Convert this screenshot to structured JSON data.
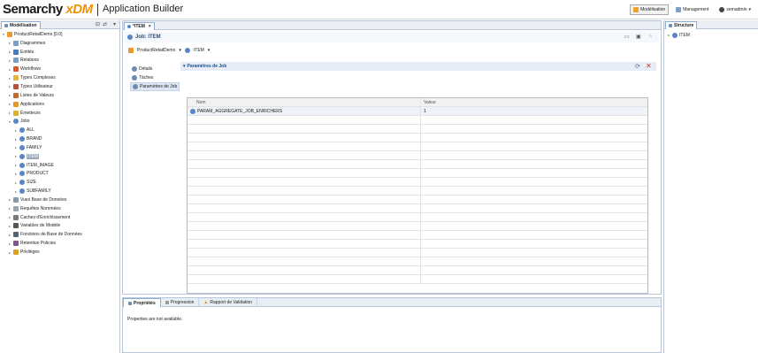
{
  "header": {
    "logo_main": "Semarchy ",
    "logo_xdm": "xDM",
    "app_title": "Application Builder",
    "buttons": [
      {
        "label": "Modélisation",
        "active": true
      },
      {
        "label": "Management",
        "active": false
      },
      {
        "label": "semadmin",
        "active": false
      }
    ]
  },
  "left": {
    "tab": "Modélisation",
    "tree": [
      {
        "label": "ProductRetailDemo [0.0]",
        "level": 0,
        "icon": "model-icon"
      },
      {
        "label": "Diagrammes",
        "level": 1,
        "icon": "diagram-icon"
      },
      {
        "label": "Entités",
        "level": 1,
        "icon": "entity-icon"
      },
      {
        "label": "Relations",
        "level": 1,
        "icon": "relation-icon"
      },
      {
        "label": "Workflows",
        "level": 1,
        "icon": "workflow-icon"
      },
      {
        "label": "Types Complexes",
        "level": 1,
        "icon": "complex-type-icon"
      },
      {
        "label": "Types Utilisateur",
        "level": 1,
        "icon": "user-type-icon"
      },
      {
        "label": "Listes de Valeurs",
        "level": 1,
        "icon": "list-icon"
      },
      {
        "label": "Applications",
        "level": 1,
        "icon": "application-icon"
      },
      {
        "label": "Émetteurs",
        "level": 1,
        "icon": "publisher-icon"
      },
      {
        "label": "Jobs",
        "level": 1,
        "icon": "job-icon"
      },
      {
        "label": "ALL",
        "level": 2,
        "icon": "job-icon"
      },
      {
        "label": "BRAND",
        "level": 2,
        "icon": "job-icon"
      },
      {
        "label": "FAMILY",
        "level": 2,
        "icon": "job-icon"
      },
      {
        "label": "ITEM",
        "level": 2,
        "icon": "job-icon",
        "selected": true
      },
      {
        "label": "ITEM_IMAGE",
        "level": 2,
        "icon": "job-icon"
      },
      {
        "label": "PRODUCT",
        "level": 2,
        "icon": "job-icon"
      },
      {
        "label": "SIZE",
        "level": 2,
        "icon": "job-icon"
      },
      {
        "label": "SUBFAMILY",
        "level": 2,
        "icon": "job-icon"
      },
      {
        "label": "Vues Base de Données",
        "level": 1,
        "icon": "db-view-icon"
      },
      {
        "label": "Requêtes Nommées",
        "level": 1,
        "icon": "query-icon"
      },
      {
        "label": "Caches d'Enrichissement",
        "level": 1,
        "icon": "cache-icon"
      },
      {
        "label": "Variables de Modèle",
        "level": 1,
        "icon": "variable-icon"
      },
      {
        "label": "Fonctions de Base de Données",
        "level": 1,
        "icon": "function-icon"
      },
      {
        "label": "Retention Policies",
        "level": 1,
        "icon": "retention-icon"
      },
      {
        "label": "Privilèges",
        "level": 1,
        "icon": "privilege-icon"
      }
    ]
  },
  "center": {
    "tab": "*ITEM",
    "editor_title": "Job: ITEM",
    "crumbs": [
      "ProductRetailDemo",
      "ITEM"
    ],
    "nav": [
      "Détails",
      "Tâches",
      "Paramètres de Job"
    ],
    "section_title": "Paramètres de Job",
    "grid": {
      "headers": [
        "Nom",
        "Valeur"
      ],
      "rows": [
        {
          "name": "PARAM_AGGREGATE_JOB_ENRICHERS",
          "value": "1"
        }
      ]
    }
  },
  "bottom": {
    "tabs": [
      "Propriétés",
      "Progression",
      "Rapport de Validation"
    ],
    "message": "Properties are not available."
  },
  "right": {
    "tab": "Structure",
    "tree": [
      "ITEM"
    ]
  },
  "colors": {
    "accent": "#1f4f84",
    "orange": "#f39200",
    "panel": "#e9eef5"
  }
}
